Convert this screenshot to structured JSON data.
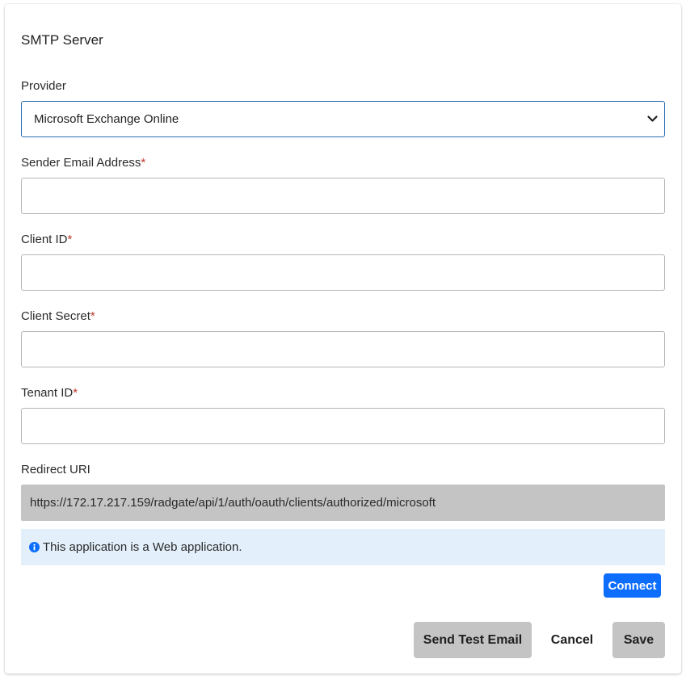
{
  "form": {
    "title": "SMTP Server",
    "provider": {
      "label": "Provider",
      "selected": "Microsoft Exchange Online"
    },
    "sender_email": {
      "label": "Sender Email Address",
      "required_mark": "*",
      "value": ""
    },
    "client_id": {
      "label": "Client ID",
      "required_mark": "*",
      "value": ""
    },
    "client_secret": {
      "label": "Client Secret",
      "required_mark": "*",
      "value": ""
    },
    "tenant_id": {
      "label": "Tenant ID",
      "required_mark": "*",
      "value": ""
    },
    "redirect_uri": {
      "label": "Redirect URI",
      "value": "https://172.17.217.159/radgate/api/1/auth/oauth/clients/authorized/microsoft"
    },
    "info_message": "This application is a Web application."
  },
  "actions": {
    "connect_label": "Connect",
    "send_test_label": "Send Test Email",
    "cancel_label": "Cancel",
    "save_label": "Save"
  },
  "colors": {
    "primary": "#0d6efd",
    "required": "#c0392b",
    "info_bg": "#e3f0fb",
    "readonly_bg": "#c4c4c4",
    "select_border": "#2f6fb3"
  },
  "icons": {
    "provider_select": "chevron-down-icon",
    "info": "info-circle-icon"
  }
}
